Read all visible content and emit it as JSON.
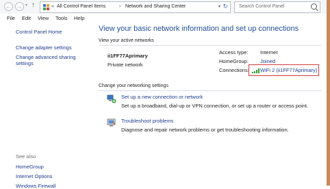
{
  "address_bar": {
    "breadcrumb": [
      "All Control Panel Items",
      "Network and Sharing Center"
    ],
    "breadcrumb_prefix": "«",
    "separator": "›",
    "search_placeholder": "Search Control Panel"
  },
  "menu": [
    "File",
    "Edit",
    "View",
    "Tools",
    "Help"
  ],
  "sidebar": {
    "home": "Control Panel Home",
    "links": [
      "Change adapter settings",
      "Change advanced sharing settings"
    ],
    "see_also_label": "See also",
    "see_also": [
      "HomeGroup",
      "Internet Options",
      "Windows Firewall"
    ]
  },
  "main": {
    "title": "View your basic network information and set up connections",
    "active_networks_label": "View your active networks",
    "network": {
      "name": "ii1FF77Aprimary",
      "type": "Private network",
      "access_type_label": "Access type:",
      "access_type_value": "Internet",
      "homegroup_label": "HomeGroup:",
      "homegroup_value": "Joined",
      "connections_label": "Connections:",
      "connections_value": "WiFi 2 (ii1FF77Aprimary)"
    },
    "change_settings_label": "Change your networking settings",
    "tasks": [
      {
        "icon": "network-setup-icon",
        "link": "Set up a new connection or network",
        "desc": "Set up a broadband, dial-up or VPN connection, or set up a router or access point."
      },
      {
        "icon": "troubleshoot-icon",
        "link": "Troubleshoot problems",
        "desc": "Diagnose and repair network problems or get troubleshooting information."
      }
    ]
  },
  "colors": {
    "link": "#1c3c8c",
    "title": "#1f4e9c",
    "highlight": "#d43b3b",
    "wifi_bars": "#2c9c2c"
  }
}
